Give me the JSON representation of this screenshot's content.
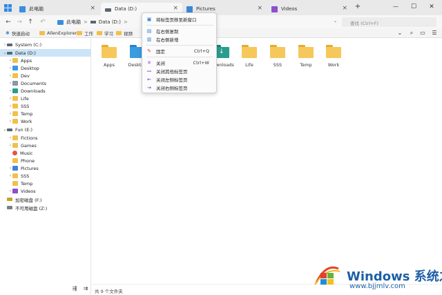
{
  "colors": {
    "accent": "#0078d4",
    "folder": "#f6c75a",
    "selection": "#cce4f7",
    "watermark": "#1d5fa8"
  },
  "tabs": [
    {
      "label": "此电脑",
      "icon": "this-pc-icon",
      "active": false
    },
    {
      "label": "Data (D:)",
      "icon": "drive-icon",
      "active": true
    },
    {
      "label": "Pictures",
      "icon": "pictures-folder-icon",
      "active": false
    },
    {
      "label": "Videos",
      "icon": "videos-folder-icon",
      "active": false
    }
  ],
  "window": {
    "new_tab": "+",
    "minimize": "—",
    "maximize": "☐",
    "close": "✕"
  },
  "address": {
    "crumbs": [
      "此电脑",
      ">",
      "Data (D:)",
      ">"
    ],
    "search_placeholder": "查找 (Ctrl+F)"
  },
  "bookmarks": [
    "快速启动",
    "AllenExplorer",
    "工作",
    "学习",
    "视频"
  ],
  "sidebar": {
    "items": [
      {
        "label": "System (C:)",
        "level": 0,
        "icon": "drive-icon",
        "selected": false
      },
      {
        "label": "Data (D:)",
        "level": 0,
        "icon": "drive-icon",
        "selected": true
      },
      {
        "label": "Apps",
        "level": 1,
        "icon": "folder-icon"
      },
      {
        "label": "Desktop",
        "level": 1,
        "icon": "desktop-folder-icon"
      },
      {
        "label": "Dev",
        "level": 1,
        "icon": "folder-icon"
      },
      {
        "label": "Documents",
        "level": 1,
        "icon": "documents-folder-icon"
      },
      {
        "label": "Downloads",
        "level": 1,
        "icon": "downloads-folder-icon"
      },
      {
        "label": "Life",
        "level": 1,
        "icon": "folder-icon"
      },
      {
        "label": "SSS",
        "level": 1,
        "icon": "folder-icon"
      },
      {
        "label": "Temp",
        "level": 1,
        "icon": "folder-icon"
      },
      {
        "label": "Work",
        "level": 1,
        "icon": "folder-icon"
      },
      {
        "label": "Fun (E:)",
        "level": 0,
        "icon": "drive-icon"
      },
      {
        "label": "Fictions",
        "level": 1,
        "icon": "folder-icon"
      },
      {
        "label": "Games",
        "level": 1,
        "icon": "folder-icon"
      },
      {
        "label": "Music",
        "level": 1,
        "icon": "music-folder-icon"
      },
      {
        "label": "Phone",
        "level": 1,
        "icon": "folder-icon"
      },
      {
        "label": "Pictures",
        "level": 1,
        "icon": "pictures-folder-icon"
      },
      {
        "label": "SSS",
        "level": 1,
        "icon": "folder-icon"
      },
      {
        "label": "Temp",
        "level": 1,
        "icon": "folder-icon"
      },
      {
        "label": "Videos",
        "level": 1,
        "icon": "videos-folder-icon"
      },
      {
        "label": "加密磁盘 (F:)",
        "level": 0,
        "icon": "encrypted-drive-icon"
      },
      {
        "label": "不可用磁盘 (Z:)",
        "level": 0,
        "icon": "unavailable-drive-icon"
      }
    ]
  },
  "content": {
    "folders": [
      "Apps",
      "Desktop",
      "",
      "",
      "Downloads",
      "Life",
      "SSS",
      "Temp",
      "Work"
    ],
    "status": "共 9 个文件夹"
  },
  "context_menu": {
    "items": [
      {
        "label": "将标签页移至新窗口",
        "icon": "new-window-icon",
        "shortcut": ""
      },
      {
        "label": "在右侧复制",
        "icon": "duplicate-tab-icon",
        "shortcut": ""
      },
      {
        "label": "在右侧新增",
        "icon": "add-tab-icon",
        "shortcut": ""
      },
      {
        "label": "固定",
        "icon": "pin-icon",
        "shortcut": "Ctrl+Q"
      },
      {
        "label": "关闭",
        "icon": "close-icon",
        "shortcut": "Ctrl+W"
      },
      {
        "label": "关闭其他标签页",
        "icon": "close-others-icon",
        "shortcut": ""
      },
      {
        "label": "关闭左侧标签页",
        "icon": "close-left-icon",
        "shortcut": ""
      },
      {
        "label": "关闭右侧标签页",
        "icon": "close-right-icon",
        "shortcut": ""
      }
    ]
  },
  "watermark": {
    "title": "Windows 系统之家",
    "url": "www.bjjmlv.com"
  }
}
